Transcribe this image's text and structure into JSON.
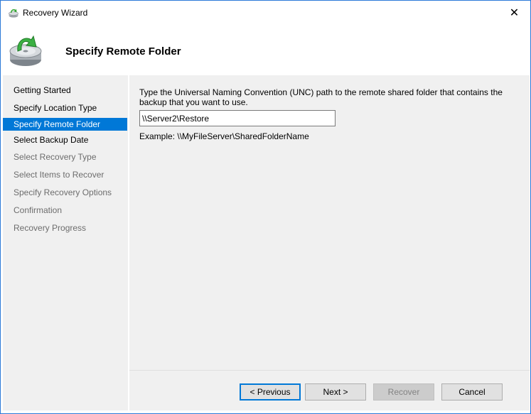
{
  "window": {
    "title": "Recovery Wizard",
    "close_symbol": "✕"
  },
  "header": {
    "title": "Specify Remote Folder"
  },
  "nav": {
    "items": [
      {
        "label": "Getting Started",
        "state": "normal"
      },
      {
        "label": "Specify Location Type",
        "state": "normal"
      },
      {
        "label": "Specify Remote Folder",
        "state": "active"
      },
      {
        "label": "Select Backup Date",
        "state": "normal"
      },
      {
        "label": "Select Recovery Type",
        "state": "disabled"
      },
      {
        "label": "Select Items to Recover",
        "state": "disabled"
      },
      {
        "label": "Specify Recovery Options",
        "state": "disabled"
      },
      {
        "label": "Confirmation",
        "state": "disabled"
      },
      {
        "label": "Recovery Progress",
        "state": "disabled"
      }
    ]
  },
  "main": {
    "instruction": "Type the Universal Naming Convention (UNC) path to the remote shared folder that contains the backup that you want to use.",
    "path_value": "\\\\Server2\\Restore",
    "example": "Example: \\\\MyFileServer\\SharedFolderName"
  },
  "buttons": {
    "previous": "< Previous",
    "next": "Next >",
    "recover": "Recover",
    "cancel": "Cancel"
  },
  "colors": {
    "accent": "#0078d7",
    "panel": "#f0f0f0",
    "disabled_text": "#6d6d6d"
  },
  "icons": {
    "title": "recovery-wizard-icon",
    "header": "disk-restore-icon",
    "close": "close-icon"
  }
}
